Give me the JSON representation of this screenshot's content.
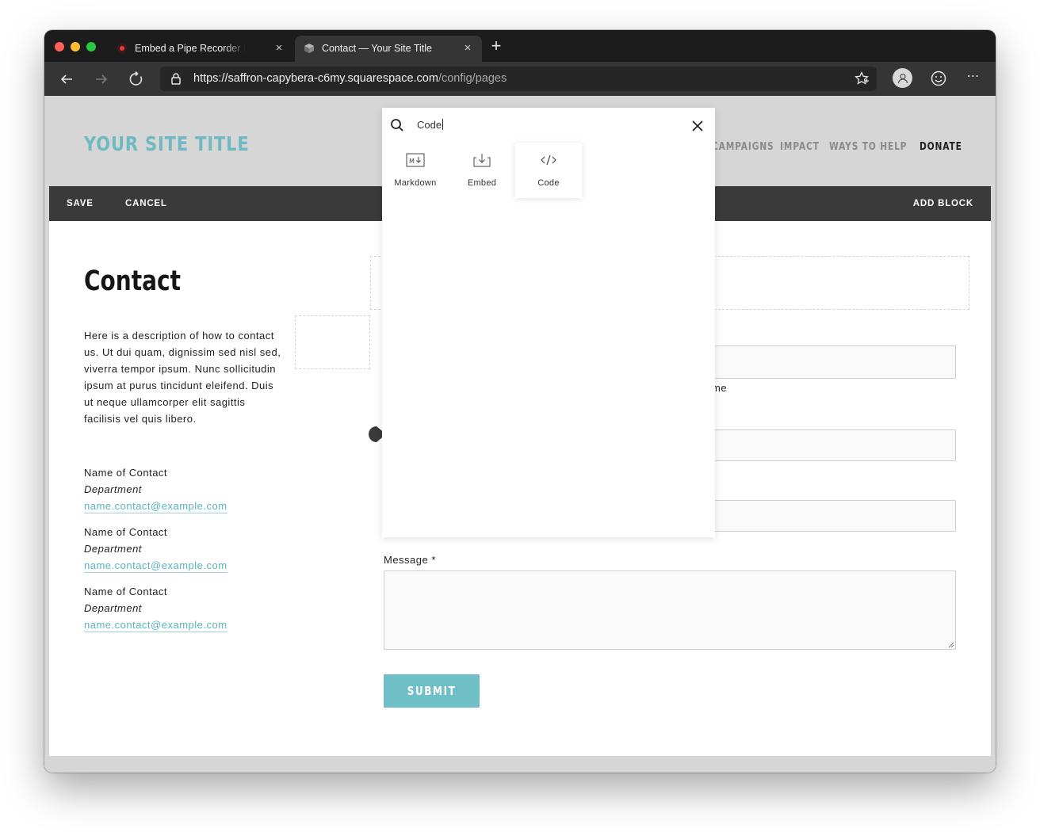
{
  "browser": {
    "tabs": [
      {
        "title": "Embed a Pipe Recorder | addpipe",
        "active": false
      },
      {
        "title": "Contact — Your Site Title",
        "active": true
      }
    ],
    "url_main": "https://saffron-capybera-c6my.squarespace.com",
    "url_path": "/config/pages",
    "tab_close_glyph": "×",
    "new_tab_glyph": "+",
    "more_glyph": "⋯"
  },
  "site": {
    "title": "YOUR SITE TITLE",
    "nav": [
      "CAMPAIGNS",
      "IMPACT",
      "WAYS TO HELP",
      "DONATE"
    ]
  },
  "edit_bar": {
    "save": "SAVE",
    "cancel": "CANCEL",
    "add_block": "ADD BLOCK"
  },
  "page": {
    "heading": "Contact",
    "description": "Here is a description of how to contact us. Ut dui quam, dignissim sed nisl sed, viverra tempor ipsum. Nunc sollicitudin ipsum at purus tincidunt eleifend. Duis ut neque ullamcorper elit sagittis facilisis vel quis libero.",
    "contacts": [
      {
        "name": "Name of Contact",
        "department": "Department",
        "email": "name.contact@example.com"
      },
      {
        "name": "Name of Contact",
        "department": "Department",
        "email": "name.contact@example.com"
      },
      {
        "name": "Name of Contact",
        "department": "Department",
        "email": "name.contact@example.com"
      }
    ]
  },
  "form": {
    "name_field_hint": "me",
    "message_label": "Message *",
    "submit": "SUBMIT"
  },
  "block_picker": {
    "search_value": "Code",
    "blocks": [
      {
        "label": "Markdown",
        "icon": "markdown-icon"
      },
      {
        "label": "Embed",
        "icon": "embed-icon"
      },
      {
        "label": "Code",
        "icon": "code-icon",
        "selected": true
      }
    ]
  },
  "colors": {
    "accent": "#6fb9c2",
    "edit_bar": "#3a3a3a",
    "header_bg": "#d6d6d6"
  }
}
